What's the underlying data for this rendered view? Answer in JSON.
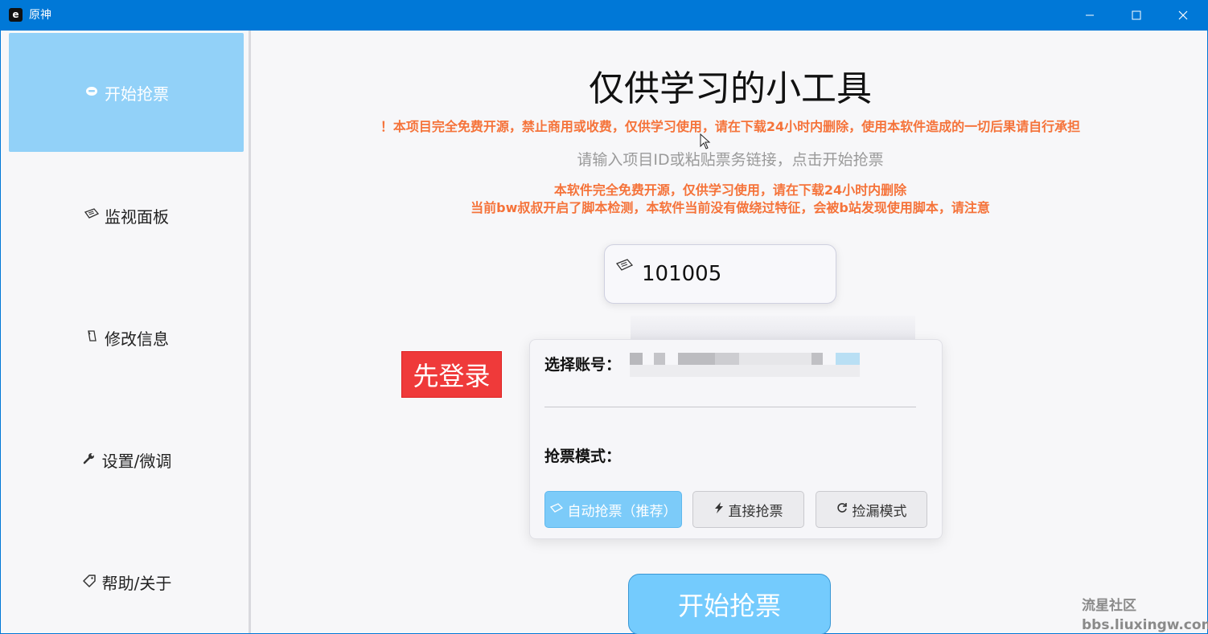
{
  "window": {
    "title": "原神",
    "app_icon_glyph": "e",
    "controls": [
      "minimize-icon",
      "maximize-icon",
      "close-icon"
    ]
  },
  "sidebar": {
    "items": [
      {
        "label": "开始抢票",
        "icon": "robot-icon",
        "active": true
      },
      {
        "label": "监视面板",
        "icon": "ticket-icon",
        "active": false
      },
      {
        "label": "修改信息",
        "icon": "edit-icon",
        "active": false
      },
      {
        "label": "设置/微调",
        "icon": "wrench-icon",
        "active": false
      },
      {
        "label": "帮助/关于",
        "icon": "tag-icon",
        "active": false
      }
    ]
  },
  "main": {
    "title": "仅供学习的小工具",
    "warning_top": "！本项目完全免费开源，禁止商用或收费，仅供学习使用，请在下载24小时内删除，使用本软件造成的一切后果请自行承担",
    "hint": "请输入项目ID或粘贴票务链接，点击开始抢票",
    "warning_line1": "本软件完全免费开源，仅供学习使用，请在下载24小时内删除",
    "warning_line2": "当前bw叔叔开启了脚本检测，本软件当前没有做绕过特征，会被b站发现使用脚本，请注意",
    "project_id": "101005",
    "login_button": "先登录",
    "account_label": "选择账号：",
    "mode_label": "抢票模式：",
    "modes": [
      {
        "label": "自动抢票（推荐）",
        "icon": "ticket-icon",
        "selected": true
      },
      {
        "label": "直接抢票",
        "icon": "lightning-icon",
        "selected": false
      },
      {
        "label": "捡漏模式",
        "icon": "refresh-icon",
        "selected": false
      }
    ],
    "start_button": "开始抢票"
  },
  "watermark": {
    "line1": "流星社区",
    "line2": "bbs.liuxingw.com"
  },
  "colors": {
    "titlebar": "#0078d7",
    "sidebar_active": "#92d1f8",
    "warning": "#f5733a",
    "login_button": "#ef3a3a",
    "primary_button": "#74cbfd"
  }
}
